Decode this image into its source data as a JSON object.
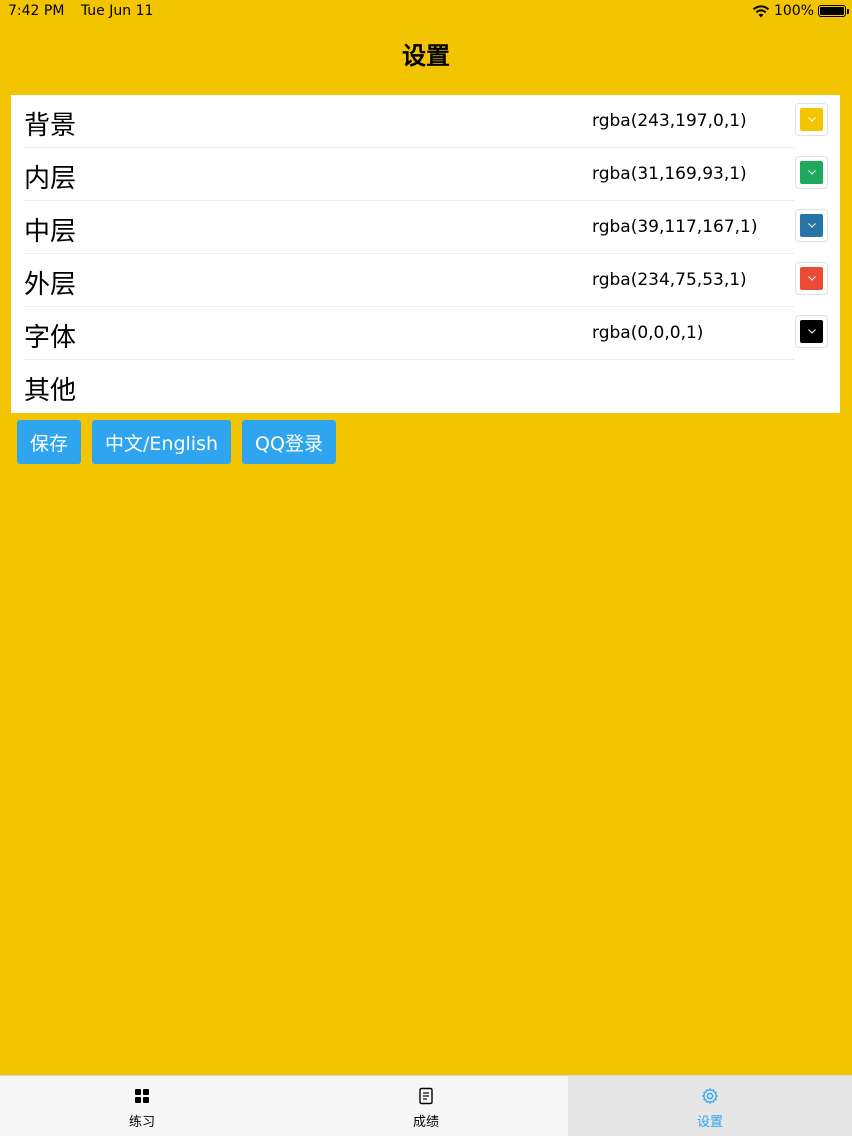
{
  "status_bar": {
    "time": "7:42 PM",
    "date": "Tue Jun 11",
    "battery": "100%"
  },
  "nav": {
    "title": "设置"
  },
  "settings": [
    {
      "label": "背景",
      "value": "rgba(243,197,0,1)",
      "color": "#f3c500"
    },
    {
      "label": "内层",
      "value": "rgba(31,169,93,1)",
      "color": "#1fa95d"
    },
    {
      "label": "中层",
      "value": "rgba(39,117,167,1)",
      "color": "#2775a7"
    },
    {
      "label": "外层",
      "value": "rgba(234,75,53,1)",
      "color": "#ea4b35"
    },
    {
      "label": "字体",
      "value": "rgba(0,0,0,1)",
      "color": "#000000"
    },
    {
      "label": "其他"
    }
  ],
  "buttons": {
    "save": "保存",
    "language": "中文/English",
    "qq_login": "QQ登录"
  },
  "tabs": [
    {
      "label": "练习",
      "icon": "grid-icon",
      "active": false
    },
    {
      "label": "成绩",
      "icon": "document-icon",
      "active": false
    },
    {
      "label": "设置",
      "icon": "gear-icon",
      "active": true
    }
  ],
  "colors": {
    "accent": "#2fa5ef",
    "background": "#f3c500"
  }
}
